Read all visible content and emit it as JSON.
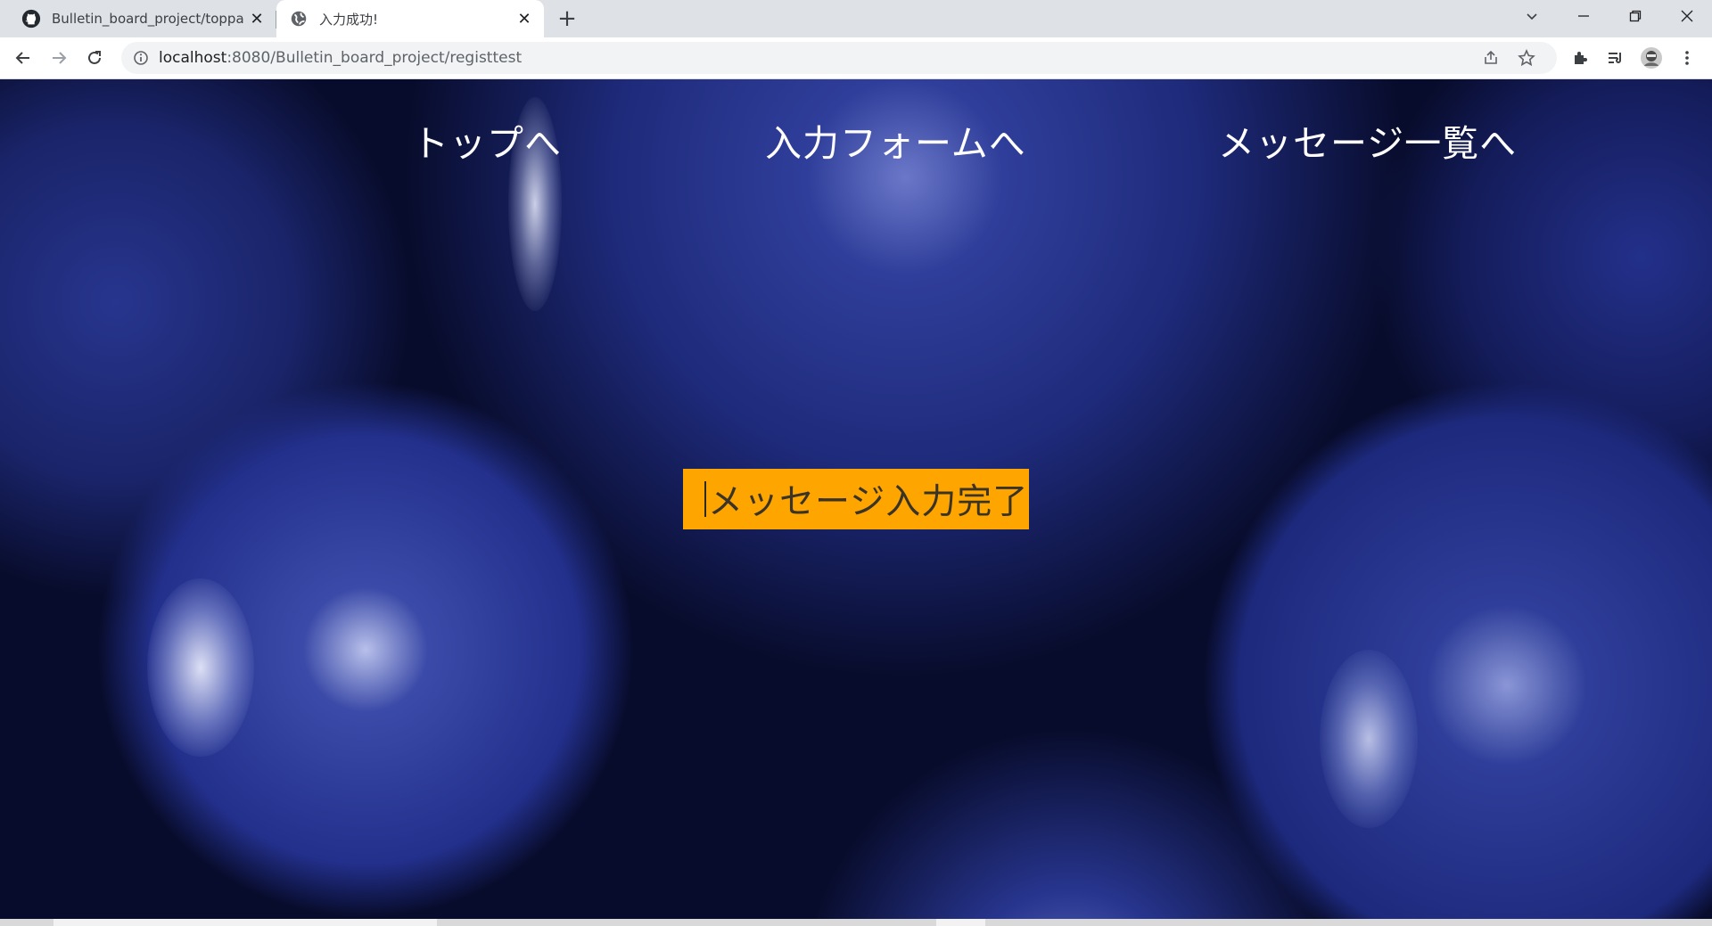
{
  "browser": {
    "tabs": [
      {
        "title": "Bulletin_board_project/toppage.j",
        "icon": "github-icon",
        "active": false
      },
      {
        "title": "入力成功!",
        "icon": "globe-icon",
        "active": true
      }
    ],
    "new_tab_label": "+",
    "url_host": "localhost",
    "url_rest": ":8080/Bulletin_board_project/registtest"
  },
  "nav": {
    "top_link": "トップへ",
    "form_link": "入力フォームへ",
    "list_link": "メッセージ一覧へ"
  },
  "message": {
    "text": "メッセージ入力完了"
  },
  "colors": {
    "accent": "#ffa500",
    "nav_text": "#ffffff",
    "background": "#1e2a7a"
  }
}
